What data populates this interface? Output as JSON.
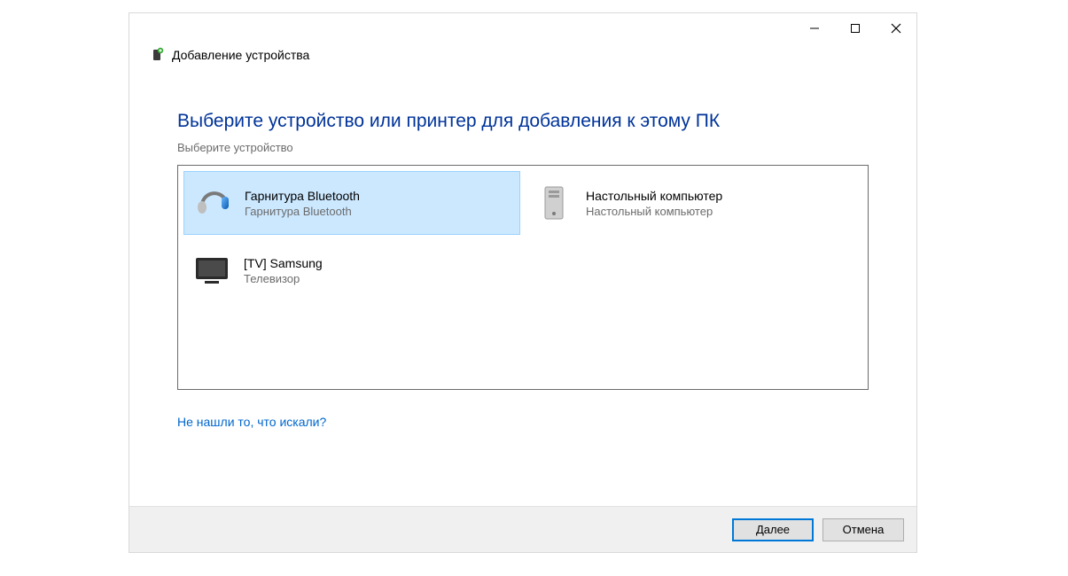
{
  "window": {
    "title": "Добавление устройства"
  },
  "main": {
    "heading": "Выберите устройство или принтер для добавления к этому ПК",
    "subheading": "Выберите устройство",
    "help_link": "Не нашли то, что искали?"
  },
  "devices": [
    {
      "name": "Гарнитура Bluetooth",
      "type": "Гарнитура Bluetooth",
      "icon": "headset-icon",
      "selected": true
    },
    {
      "name": "Настольный компьютер",
      "type": "Настольный компьютер",
      "icon": "desktop-icon",
      "selected": false
    },
    {
      "name": "[TV] Samsung",
      "type": "Телевизор",
      "icon": "tv-icon",
      "selected": false
    }
  ],
  "footer": {
    "next_label": "Далее",
    "cancel_label": "Отмена"
  }
}
